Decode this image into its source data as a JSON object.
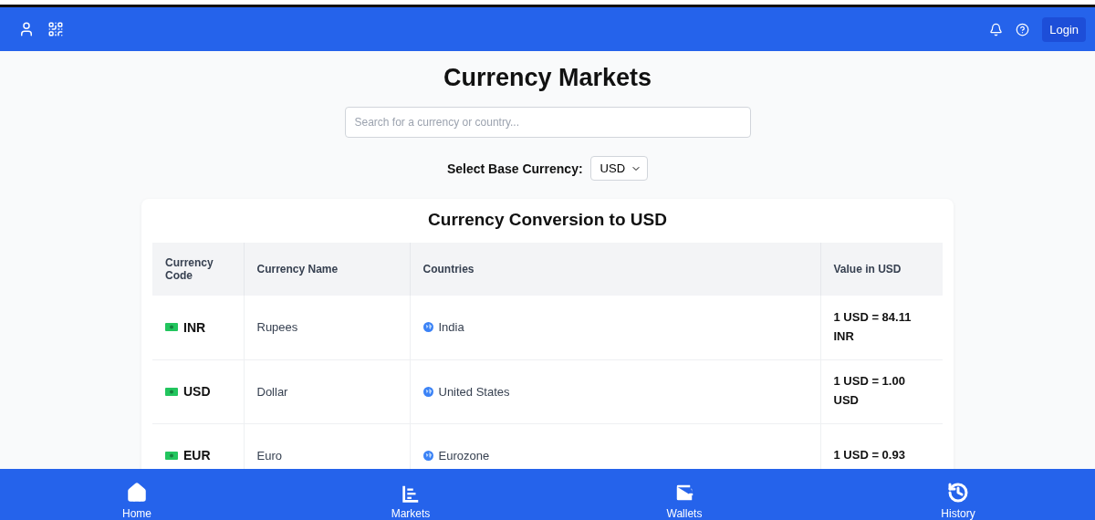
{
  "header": {
    "login": "Login"
  },
  "title": "Currency Markets",
  "search": {
    "placeholder": "Search for a currency or country..."
  },
  "base": {
    "label": "Select Base Currency:",
    "value": "USD"
  },
  "table": {
    "title": "Currency Conversion to USD",
    "columns": [
      "Currency Code",
      "Currency Name",
      "Countries",
      "Value in USD"
    ],
    "rows": [
      {
        "code": "INR",
        "name": "Rupees",
        "country": "India",
        "value": "1 USD = 84.11 INR"
      },
      {
        "code": "USD",
        "name": "Dollar",
        "country": "United States",
        "value": "1 USD = 1.00 USD"
      },
      {
        "code": "EUR",
        "name": "Euro",
        "country": "Eurozone",
        "value": "1 USD = 0.93"
      }
    ]
  },
  "nav": [
    {
      "kind": "home",
      "label": "Home"
    },
    {
      "kind": "markets",
      "label": "Markets"
    },
    {
      "kind": "wallets",
      "label": "Wallets"
    },
    {
      "kind": "history",
      "label": "History"
    }
  ]
}
